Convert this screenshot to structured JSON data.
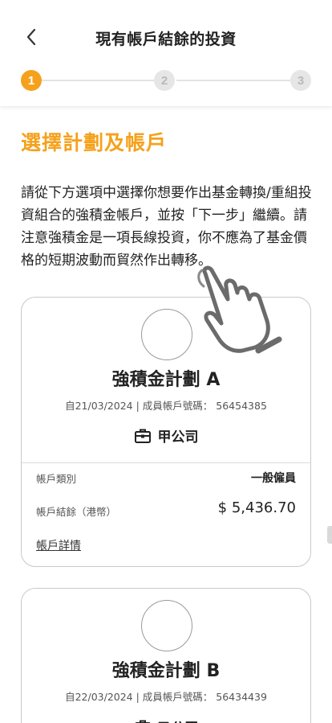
{
  "header": {
    "title": "現有帳戶結餘的投資",
    "back_icon": "chevron-left-icon",
    "steps": [
      "1",
      "2",
      "3"
    ],
    "active_step": 1,
    "accent_color": "#f5a11c"
  },
  "main": {
    "heading": "選擇計劃及帳戶",
    "instructions": "請從下方選項中選擇你想要作出基金轉換/重組投資組合的強積金帳戶，並按「下一步」繼續。請注意強積金是一項長線投資，你不應為了基金價格的短期波動而貿然作出轉移。"
  },
  "cards": [
    {
      "plan_name": "強積金計劃 A",
      "subtitle": "自21/03/2024 | 成員帳戶號碼： 56454385",
      "company_icon": "briefcase-icon",
      "company": "甲公司",
      "account_type_label": "帳戶類別",
      "account_type": "一般僱員",
      "balance_label": "帳戶結餘（港幣）",
      "balance": "$ 5,436.70",
      "details_link": "帳戶詳情"
    },
    {
      "plan_name": "強積金計劃 B",
      "subtitle": "自22/03/2024 | 成員帳戶號碼： 56434439",
      "company_icon": "briefcase-icon",
      "company": "乙公司"
    }
  ],
  "overlay": {
    "icon": "pointing-hand-icon"
  }
}
